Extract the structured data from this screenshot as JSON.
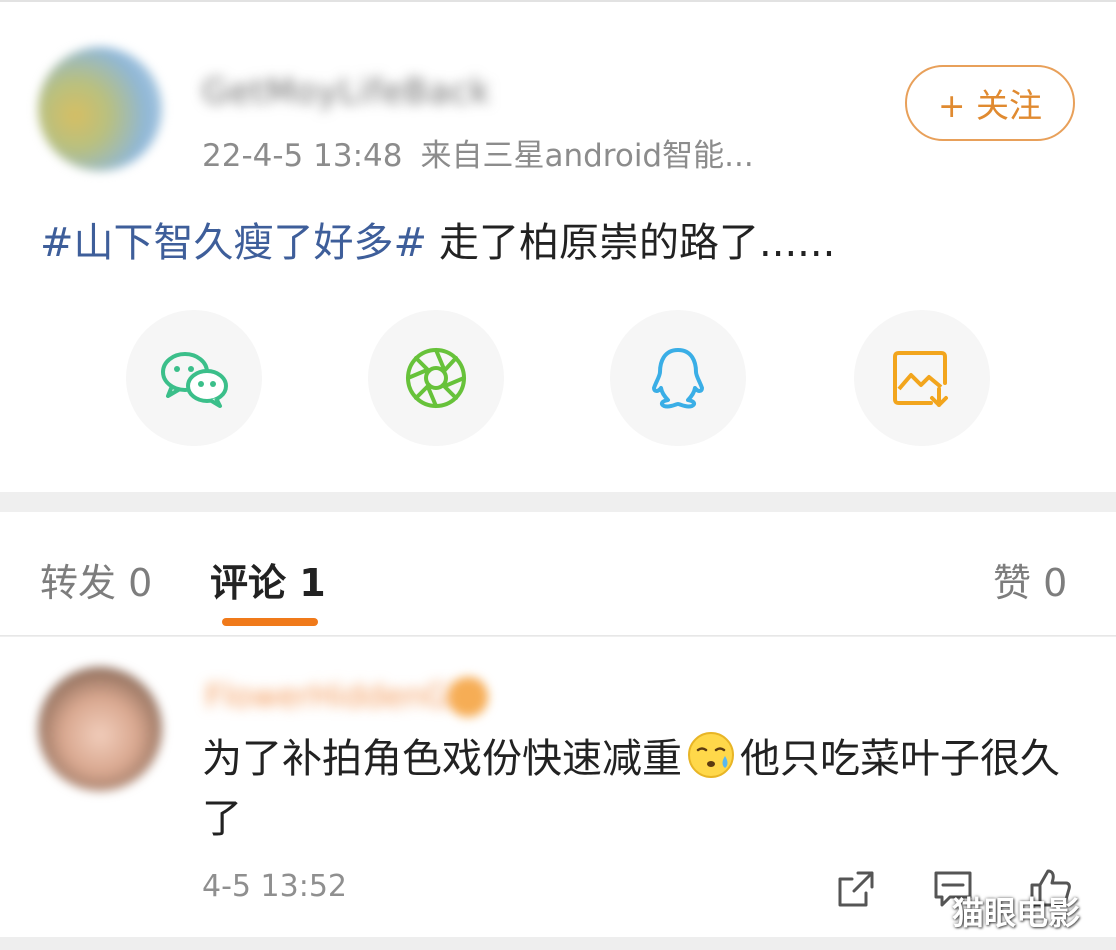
{
  "post": {
    "username": "GetMoyLifeBack",
    "date": "22-4-5 13:48",
    "source": "来自三星android智能...",
    "follow_label": "+ 关注",
    "hashtag": "#山下智久瘦了好多#",
    "text": "走了柏原崇的路了......"
  },
  "share": {
    "items": [
      {
        "icon": "wechat-icon"
      },
      {
        "icon": "moments-icon"
      },
      {
        "icon": "qq-icon"
      },
      {
        "icon": "save-image-icon"
      }
    ]
  },
  "tabs": {
    "repost_label": "转发 0",
    "comment_label": "评论 1",
    "like_label": "赞 0"
  },
  "comment": {
    "username": "FlowerHiddenGirl",
    "text_before_emoji": "为了补拍角色戏份快速减重",
    "emoji": "sweat-face-emoji",
    "text_after_emoji": "他只吃菜叶子很久了",
    "time": "4-5 13:52"
  },
  "watermark": "猫眼电影",
  "colors": {
    "accent": "#f07a1a",
    "hashtag": "#3e5e9a",
    "wechat": "#3bbf8a",
    "moments": "#67c23a",
    "qq": "#3aaee6",
    "save": "#f2a51d"
  }
}
